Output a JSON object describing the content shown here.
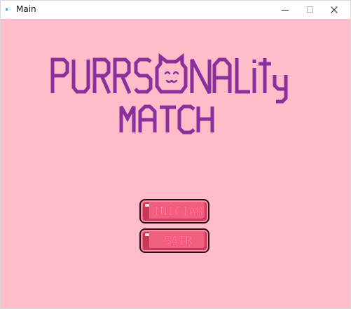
{
  "window": {
    "title": "Main",
    "controls": {
      "minimize_icon": "minimize-icon",
      "maximize_icon": "maximize-icon",
      "close_icon": "close-icon"
    }
  },
  "game": {
    "background_color": "#ffbdca",
    "title_line1": "PURRSONALITY",
    "title_line2": "MATCH",
    "title_color": "#8a2f9b",
    "menu": {
      "start_label": "INICIAR",
      "exit_label": "SAIR"
    },
    "button_color": "#f0607f"
  }
}
